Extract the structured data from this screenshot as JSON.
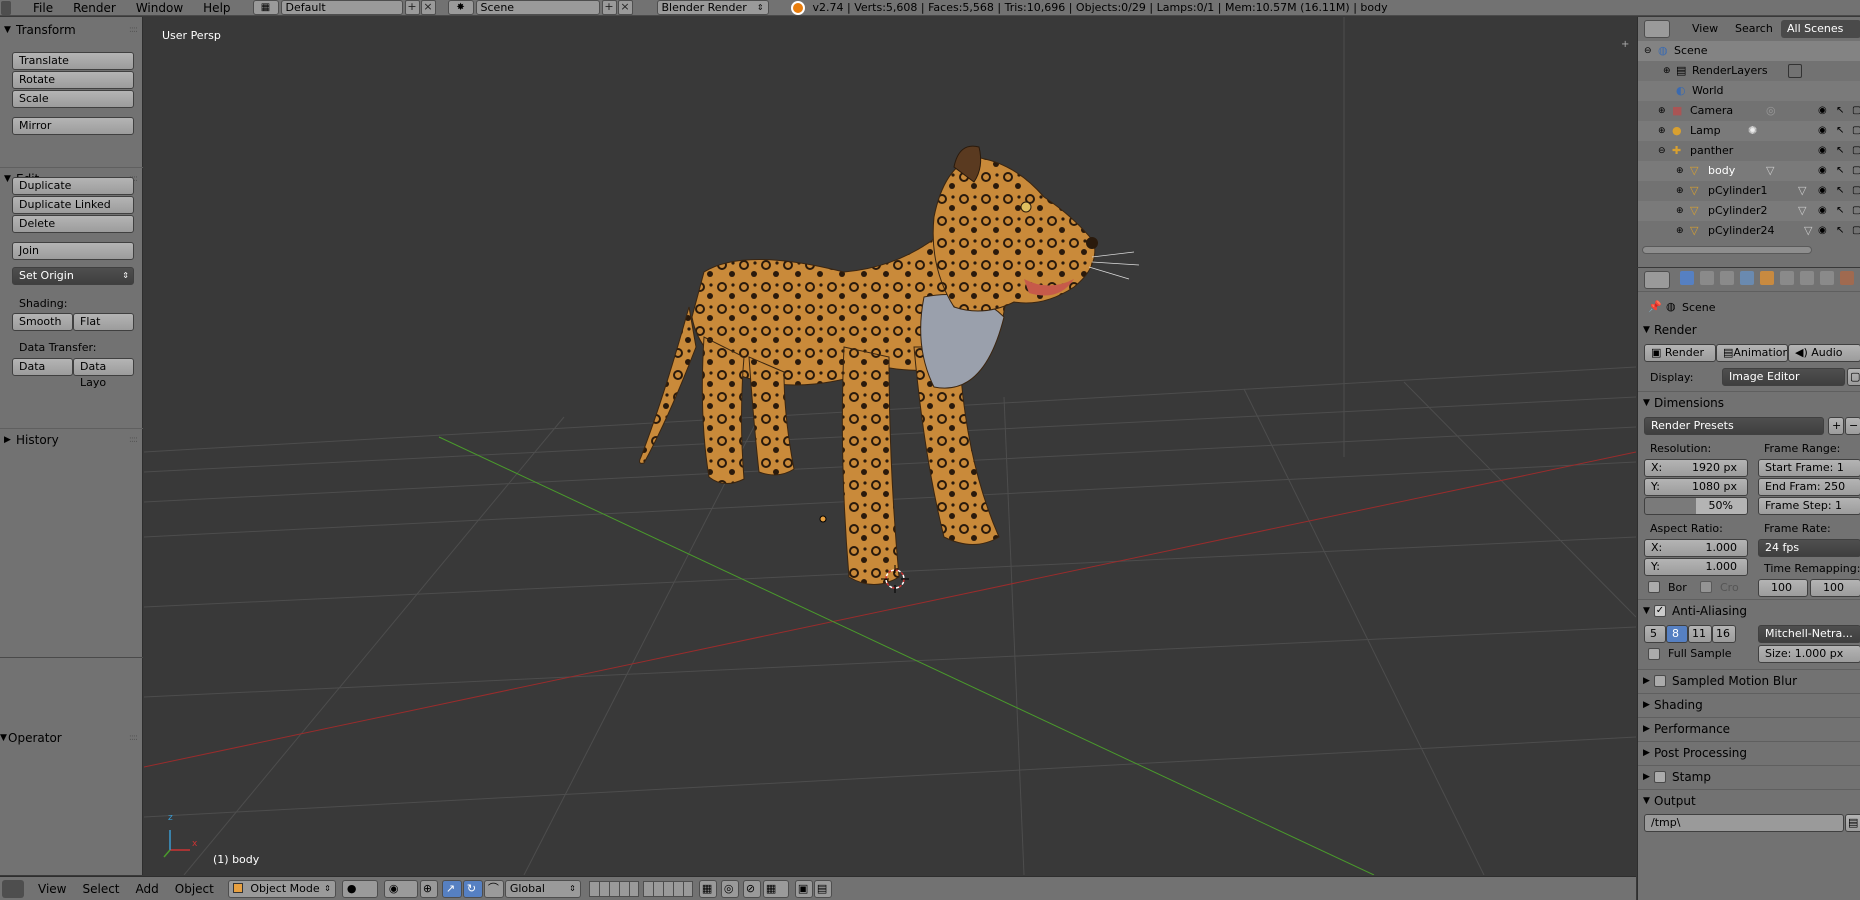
{
  "top_bar": {
    "menus": [
      "File",
      "Render",
      "Window",
      "Help"
    ],
    "screen_layout": "Default",
    "scene": "Scene",
    "render_engine": "Blender Render",
    "stats": "v2.74 | Verts:5,608 | Faces:5,568 | Tris:10,696 | Objects:0/29 | Lamps:0/1 | Mem:10.57M (16.11M) | body"
  },
  "tool_shelf": {
    "transform_title": "Transform",
    "translate": "Translate",
    "rotate": "Rotate",
    "scale": "Scale",
    "mirror": "Mirror",
    "edit_title": "Edit",
    "duplicate": "Duplicate",
    "duplicate_linked": "Duplicate Linked",
    "delete": "Delete",
    "join": "Join",
    "set_origin": "Set Origin",
    "shading_label": "Shading:",
    "smooth": "Smooth",
    "flat": "Flat",
    "data_transfer_label": "Data Transfer:",
    "data": "Data",
    "data_layout": "Data Layo",
    "history_title": "History",
    "operator_title": "Operator"
  },
  "viewport": {
    "view_name": "User Persp",
    "object_label": "(1) body",
    "axis_x": "x",
    "axis_z": "z"
  },
  "bottom_bar": {
    "menus": [
      "View",
      "Select",
      "Add",
      "Object"
    ],
    "mode": "Object Mode",
    "orientation": "Global"
  },
  "outliner": {
    "header_tabs": [
      "View",
      "Search",
      "All Scenes"
    ],
    "rows": [
      {
        "label": "Scene"
      },
      {
        "label": "RenderLayers"
      },
      {
        "label": "World"
      },
      {
        "label": "Camera"
      },
      {
        "label": "Lamp"
      },
      {
        "label": "panther"
      },
      {
        "label": "body"
      },
      {
        "label": "pCylinder1"
      },
      {
        "label": "pCylinder2"
      },
      {
        "label": "pCylinder24"
      }
    ]
  },
  "properties": {
    "context": "Scene",
    "render_title": "Render",
    "render_btn": "Render",
    "animation_btn": "Animation",
    "audio_btn": "Audio",
    "display_label": "Display:",
    "display_value": "Image Editor",
    "dimensions_title": "Dimensions",
    "render_presets": "Render Presets",
    "resolution_label": "Resolution:",
    "res_x_label": "X:",
    "res_x": "1920 px",
    "res_y_label": "Y:",
    "res_y": "1080 px",
    "res_pct": "50%",
    "frame_range_label": "Frame Range:",
    "start_frame": "Start Frame: 1",
    "end_frame": "End Fram: 250",
    "frame_step": "Frame Step: 1",
    "aspect_label": "Aspect Ratio:",
    "aspect_x_label": "X:",
    "aspect_x": "1.000",
    "aspect_y_label": "Y:",
    "aspect_y": "1.000",
    "frame_rate_label": "Frame Rate:",
    "frame_rate": "24 fps",
    "time_remap_label": "Time Remapping:",
    "remap_old": "100",
    "remap_new": "100",
    "border": "Bor",
    "crop": "Cro",
    "aa_title": "Anti-Aliasing",
    "aa_samples": [
      "5",
      "8",
      "11",
      "16"
    ],
    "aa_filter": "Mitchell-Netra...",
    "full_sample": "Full Sample",
    "aa_size": "Size: 1.000 px",
    "motion_blur": "Sampled Motion Blur",
    "shading": "Shading",
    "performance": "Performance",
    "post_processing": "Post Processing",
    "stamp": "Stamp",
    "output": "Output",
    "output_path": "/tmp\\"
  },
  "colors": {
    "ui_bg": "#727272",
    "viewport_bg": "#393939",
    "selected_blue": "#5680c2",
    "grid_red": "#9a2c2c",
    "grid_green": "#4a9a2c"
  }
}
